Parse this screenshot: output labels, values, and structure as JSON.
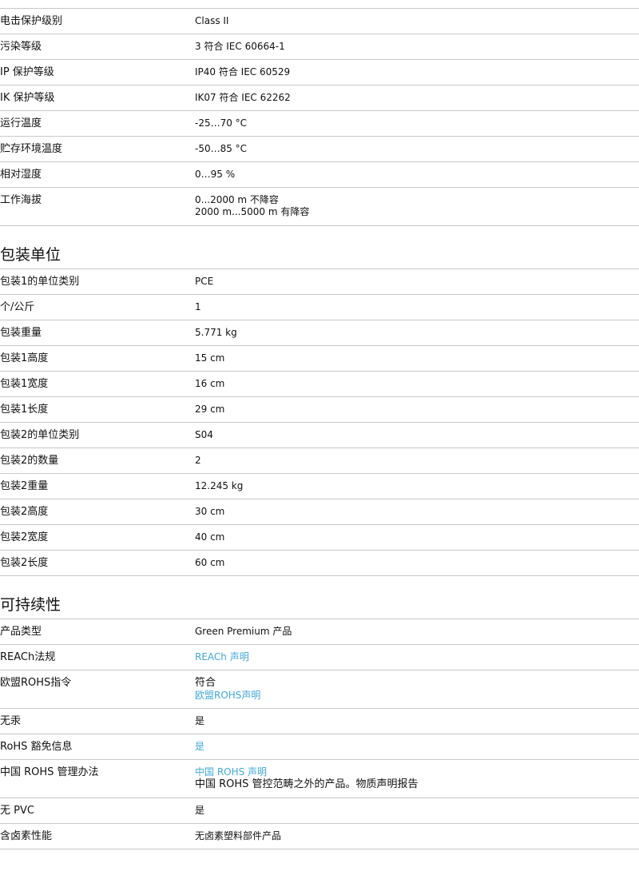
{
  "spec_rows": [
    {
      "label": "电击保护级别",
      "value": "Class II"
    },
    {
      "label": "污染等级",
      "value": "3 符合 IEC 60664-1"
    },
    {
      "label": "IP 保护等级",
      "value": "IP40 符合 IEC 60529"
    },
    {
      "label": "IK 保护等级",
      "value": "IK07 符合 IEC 62262"
    },
    {
      "label": "运行温度",
      "value": "-25…70 °C"
    },
    {
      "label": "贮存环境温度",
      "value": "-50…85 °C"
    },
    {
      "label": "相对湿度",
      "value": "0…95 %"
    },
    {
      "label": "工作海拔",
      "value_line1": "0...2000 m 不降容",
      "value_line2": "2000 m...5000 m 有降容"
    }
  ],
  "packaging": {
    "title": "包装单位",
    "rows": [
      {
        "label": "包装1的单位类别",
        "value": "PCE"
      },
      {
        "label": "个/公斤",
        "value": "1"
      },
      {
        "label": "包装重量",
        "value": "5.771 kg"
      },
      {
        "label": "包装1高度",
        "value": "15 cm"
      },
      {
        "label": "包装1宽度",
        "value": "16 cm"
      },
      {
        "label": "包装1长度",
        "value": "29 cm"
      },
      {
        "label": "包装2的单位类别",
        "value": "S04"
      },
      {
        "label": "包装2的数量",
        "value": "2"
      },
      {
        "label": "包装2重量",
        "value": "12.245 kg"
      },
      {
        "label": "包装2高度",
        "value": "30 cm"
      },
      {
        "label": "包装2宽度",
        "value": "40 cm"
      },
      {
        "label": "包装2长度",
        "value": "60 cm"
      }
    ]
  },
  "sustainability": {
    "title": "可持续性",
    "product_type": {
      "label": "产品类型",
      "value": "Green Premium 产品"
    },
    "reach": {
      "label": "REACh法规",
      "link": "REACh 声明"
    },
    "eu_rohs": {
      "label": "欧盟ROHS指令",
      "value": "符合",
      "link": "欧盟ROHS声明"
    },
    "mercury_free": {
      "label": "无汞",
      "value": "是"
    },
    "rohs_exemption": {
      "label": "RoHS 豁免信息",
      "link": "是"
    },
    "china_rohs": {
      "label": "中国 ROHS 管理办法",
      "link": "中国 ROHS 声明",
      "value": "中国 ROHS 管控范畴之外的产品。物质声明报告"
    },
    "pvc_free": {
      "label": "无 PVC",
      "value": "是"
    },
    "halogen": {
      "label": "含卤素性能",
      "value": "无卤素塑料部件产品"
    }
  },
  "colors": {
    "link": "#3fa9d8",
    "rule": "#c8c8c8"
  }
}
